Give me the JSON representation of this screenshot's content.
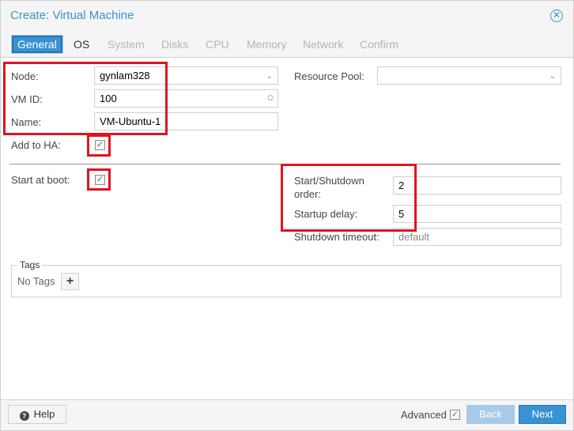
{
  "dialog": {
    "title": "Create: Virtual Machine"
  },
  "tabs": [
    {
      "label": "General"
    },
    {
      "label": "OS"
    },
    {
      "label": "System"
    },
    {
      "label": "Disks"
    },
    {
      "label": "CPU"
    },
    {
      "label": "Memory"
    },
    {
      "label": "Network"
    },
    {
      "label": "Confirm"
    }
  ],
  "general": {
    "node_label": "Node:",
    "node_value": "gynlam328",
    "vmid_label": "VM ID:",
    "vmid_value": "100",
    "name_label": "Name:",
    "name_value": "VM-Ubuntu-1",
    "resource_pool_label": "Resource Pool:",
    "resource_pool_value": "",
    "add_ha_label": "Add to HA:",
    "add_ha_checked": true,
    "start_boot_label": "Start at boot:",
    "start_boot_checked": true,
    "order_label": "Start/Shutdown order:",
    "order_value": "2",
    "startup_delay_label": "Startup delay:",
    "startup_delay_value": "5",
    "shutdown_timeout_label": "Shutdown timeout:",
    "shutdown_timeout_placeholder": "default"
  },
  "tags": {
    "legend": "Tags",
    "empty_text": "No Tags",
    "add_symbol": "+"
  },
  "footer": {
    "help_label": "Help",
    "advanced_label": "Advanced",
    "advanced_checked": true,
    "back_label": "Back",
    "next_label": "Next"
  },
  "colors": {
    "accent": "#3892d4",
    "highlight": "#e2131f"
  }
}
